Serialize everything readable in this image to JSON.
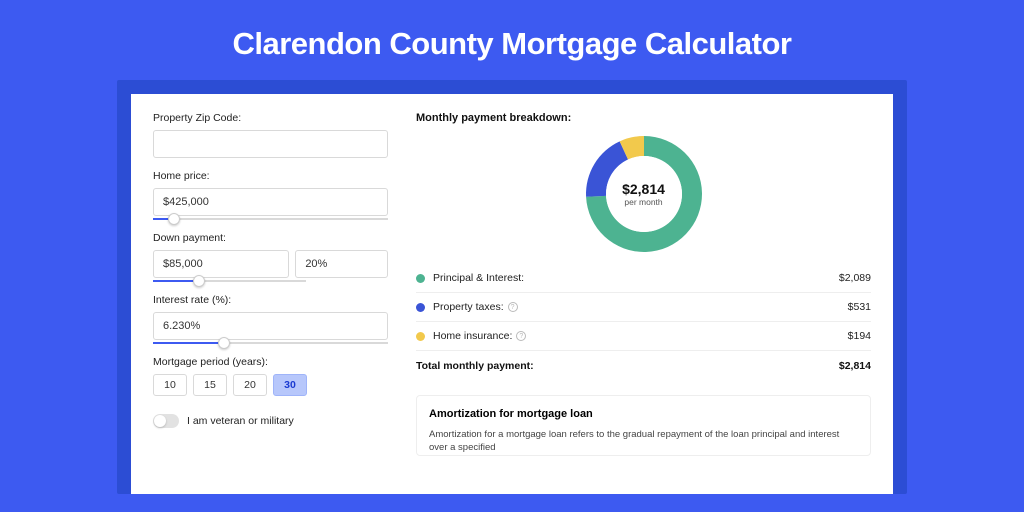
{
  "title": "Clarendon County Mortgage Calculator",
  "left": {
    "zip": {
      "label": "Property Zip Code:",
      "value": ""
    },
    "home_price": {
      "label": "Home price:",
      "value": "$425,000",
      "slider_pct": 9
    },
    "down_payment": {
      "label": "Down payment:",
      "amount": "$85,000",
      "percent": "20%",
      "slider_pct": 20
    },
    "rate": {
      "label": "Interest rate (%):",
      "value": "6.230%",
      "slider_pct": 30
    },
    "period": {
      "label": "Mortgage period (years):",
      "options": [
        "10",
        "15",
        "20",
        "30"
      ],
      "active": "30"
    },
    "veteran": {
      "label": "I am veteran or military",
      "on": false
    }
  },
  "right": {
    "heading": "Monthly payment breakdown:",
    "donut": {
      "amount": "$2,814",
      "sub": "per month"
    },
    "legend": [
      {
        "color": "#4db391",
        "label": "Principal & Interest:",
        "value": "$2,089",
        "info": false
      },
      {
        "color": "#3a54d6",
        "label": "Property taxes:",
        "value": "$531",
        "info": true
      },
      {
        "color": "#f2c94c",
        "label": "Home insurance:",
        "value": "$194",
        "info": true
      }
    ],
    "total": {
      "label": "Total monthly payment:",
      "value": "$2,814"
    },
    "amort": {
      "title": "Amortization for mortgage loan",
      "text": "Amortization for a mortgage loan refers to the gradual repayment of the loan principal and interest over a specified"
    }
  },
  "chart_data": {
    "type": "pie",
    "title": "Monthly payment breakdown",
    "series": [
      {
        "name": "Principal & Interest",
        "value": 2089,
        "color": "#4db391"
      },
      {
        "name": "Property taxes",
        "value": 531,
        "color": "#3a54d6"
      },
      {
        "name": "Home insurance",
        "value": 194,
        "color": "#f2c94c"
      }
    ],
    "total": 2814,
    "center_label": "$2,814 per month"
  }
}
